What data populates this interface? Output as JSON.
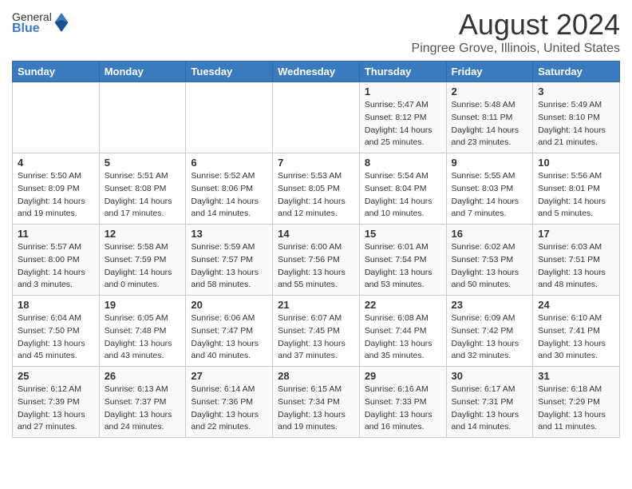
{
  "logo": {
    "general": "General",
    "blue": "Blue"
  },
  "title": "August 2024",
  "location": "Pingree Grove, Illinois, United States",
  "days_of_week": [
    "Sunday",
    "Monday",
    "Tuesday",
    "Wednesday",
    "Thursday",
    "Friday",
    "Saturday"
  ],
  "weeks": [
    [
      {
        "day": "",
        "info": ""
      },
      {
        "day": "",
        "info": ""
      },
      {
        "day": "",
        "info": ""
      },
      {
        "day": "",
        "info": ""
      },
      {
        "day": "1",
        "info": "Sunrise: 5:47 AM\nSunset: 8:12 PM\nDaylight: 14 hours\nand 25 minutes."
      },
      {
        "day": "2",
        "info": "Sunrise: 5:48 AM\nSunset: 8:11 PM\nDaylight: 14 hours\nand 23 minutes."
      },
      {
        "day": "3",
        "info": "Sunrise: 5:49 AM\nSunset: 8:10 PM\nDaylight: 14 hours\nand 21 minutes."
      }
    ],
    [
      {
        "day": "4",
        "info": "Sunrise: 5:50 AM\nSunset: 8:09 PM\nDaylight: 14 hours\nand 19 minutes."
      },
      {
        "day": "5",
        "info": "Sunrise: 5:51 AM\nSunset: 8:08 PM\nDaylight: 14 hours\nand 17 minutes."
      },
      {
        "day": "6",
        "info": "Sunrise: 5:52 AM\nSunset: 8:06 PM\nDaylight: 14 hours\nand 14 minutes."
      },
      {
        "day": "7",
        "info": "Sunrise: 5:53 AM\nSunset: 8:05 PM\nDaylight: 14 hours\nand 12 minutes."
      },
      {
        "day": "8",
        "info": "Sunrise: 5:54 AM\nSunset: 8:04 PM\nDaylight: 14 hours\nand 10 minutes."
      },
      {
        "day": "9",
        "info": "Sunrise: 5:55 AM\nSunset: 8:03 PM\nDaylight: 14 hours\nand 7 minutes."
      },
      {
        "day": "10",
        "info": "Sunrise: 5:56 AM\nSunset: 8:01 PM\nDaylight: 14 hours\nand 5 minutes."
      }
    ],
    [
      {
        "day": "11",
        "info": "Sunrise: 5:57 AM\nSunset: 8:00 PM\nDaylight: 14 hours\nand 3 minutes."
      },
      {
        "day": "12",
        "info": "Sunrise: 5:58 AM\nSunset: 7:59 PM\nDaylight: 14 hours\nand 0 minutes."
      },
      {
        "day": "13",
        "info": "Sunrise: 5:59 AM\nSunset: 7:57 PM\nDaylight: 13 hours\nand 58 minutes."
      },
      {
        "day": "14",
        "info": "Sunrise: 6:00 AM\nSunset: 7:56 PM\nDaylight: 13 hours\nand 55 minutes."
      },
      {
        "day": "15",
        "info": "Sunrise: 6:01 AM\nSunset: 7:54 PM\nDaylight: 13 hours\nand 53 minutes."
      },
      {
        "day": "16",
        "info": "Sunrise: 6:02 AM\nSunset: 7:53 PM\nDaylight: 13 hours\nand 50 minutes."
      },
      {
        "day": "17",
        "info": "Sunrise: 6:03 AM\nSunset: 7:51 PM\nDaylight: 13 hours\nand 48 minutes."
      }
    ],
    [
      {
        "day": "18",
        "info": "Sunrise: 6:04 AM\nSunset: 7:50 PM\nDaylight: 13 hours\nand 45 minutes."
      },
      {
        "day": "19",
        "info": "Sunrise: 6:05 AM\nSunset: 7:48 PM\nDaylight: 13 hours\nand 43 minutes."
      },
      {
        "day": "20",
        "info": "Sunrise: 6:06 AM\nSunset: 7:47 PM\nDaylight: 13 hours\nand 40 minutes."
      },
      {
        "day": "21",
        "info": "Sunrise: 6:07 AM\nSunset: 7:45 PM\nDaylight: 13 hours\nand 37 minutes."
      },
      {
        "day": "22",
        "info": "Sunrise: 6:08 AM\nSunset: 7:44 PM\nDaylight: 13 hours\nand 35 minutes."
      },
      {
        "day": "23",
        "info": "Sunrise: 6:09 AM\nSunset: 7:42 PM\nDaylight: 13 hours\nand 32 minutes."
      },
      {
        "day": "24",
        "info": "Sunrise: 6:10 AM\nSunset: 7:41 PM\nDaylight: 13 hours\nand 30 minutes."
      }
    ],
    [
      {
        "day": "25",
        "info": "Sunrise: 6:12 AM\nSunset: 7:39 PM\nDaylight: 13 hours\nand 27 minutes."
      },
      {
        "day": "26",
        "info": "Sunrise: 6:13 AM\nSunset: 7:37 PM\nDaylight: 13 hours\nand 24 minutes."
      },
      {
        "day": "27",
        "info": "Sunrise: 6:14 AM\nSunset: 7:36 PM\nDaylight: 13 hours\nand 22 minutes."
      },
      {
        "day": "28",
        "info": "Sunrise: 6:15 AM\nSunset: 7:34 PM\nDaylight: 13 hours\nand 19 minutes."
      },
      {
        "day": "29",
        "info": "Sunrise: 6:16 AM\nSunset: 7:33 PM\nDaylight: 13 hours\nand 16 minutes."
      },
      {
        "day": "30",
        "info": "Sunrise: 6:17 AM\nSunset: 7:31 PM\nDaylight: 13 hours\nand 14 minutes."
      },
      {
        "day": "31",
        "info": "Sunrise: 6:18 AM\nSunset: 7:29 PM\nDaylight: 13 hours\nand 11 minutes."
      }
    ]
  ]
}
